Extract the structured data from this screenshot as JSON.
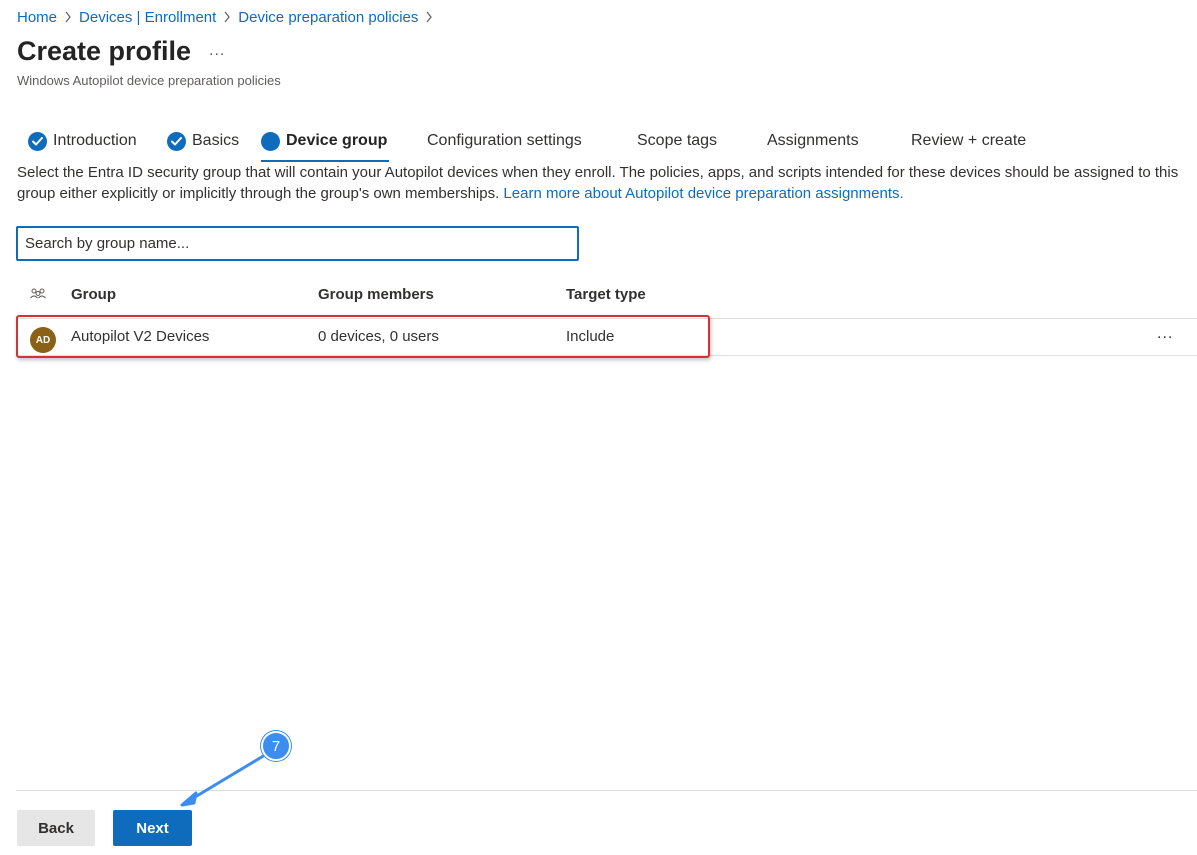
{
  "breadcrumb": [
    {
      "label": "Home"
    },
    {
      "label": "Devices | Enrollment"
    },
    {
      "label": "Device preparation policies"
    }
  ],
  "header": {
    "title": "Create profile",
    "more": "...",
    "subtitle": "Windows Autopilot device preparation policies"
  },
  "tabs": [
    {
      "label": "Introduction",
      "state": "completed"
    },
    {
      "label": "Basics",
      "state": "completed"
    },
    {
      "label": "Device group",
      "state": "current"
    },
    {
      "label": "Configuration settings",
      "state": "pending"
    },
    {
      "label": "Scope tags",
      "state": "pending"
    },
    {
      "label": "Assignments",
      "state": "pending"
    },
    {
      "label": "Review + create",
      "state": "pending"
    }
  ],
  "description": {
    "text": "Select the Entra ID security group that will contain your Autopilot devices when they enroll. The policies, apps, and scripts intended for these devices should be assigned to this group either explicitly or implicitly through the group's own memberships. ",
    "link": "Learn more about Autopilot device preparation assignments."
  },
  "search": {
    "placeholder": "Search by group name...",
    "value": ""
  },
  "table": {
    "columns": [
      "Group",
      "Group members",
      "Target type"
    ],
    "rows": [
      {
        "initials": "AD",
        "group": "Autopilot V2 Devices",
        "members": "0 devices, 0 users",
        "target": "Include",
        "more": "..."
      }
    ]
  },
  "footer": {
    "back_label": "Back",
    "next_label": "Next"
  },
  "annotation": {
    "step": "7"
  },
  "colors": {
    "accent": "#0f6cbd",
    "highlight": "#d13438",
    "avatar": "#8a6116",
    "callout": "#3b8ef0"
  }
}
